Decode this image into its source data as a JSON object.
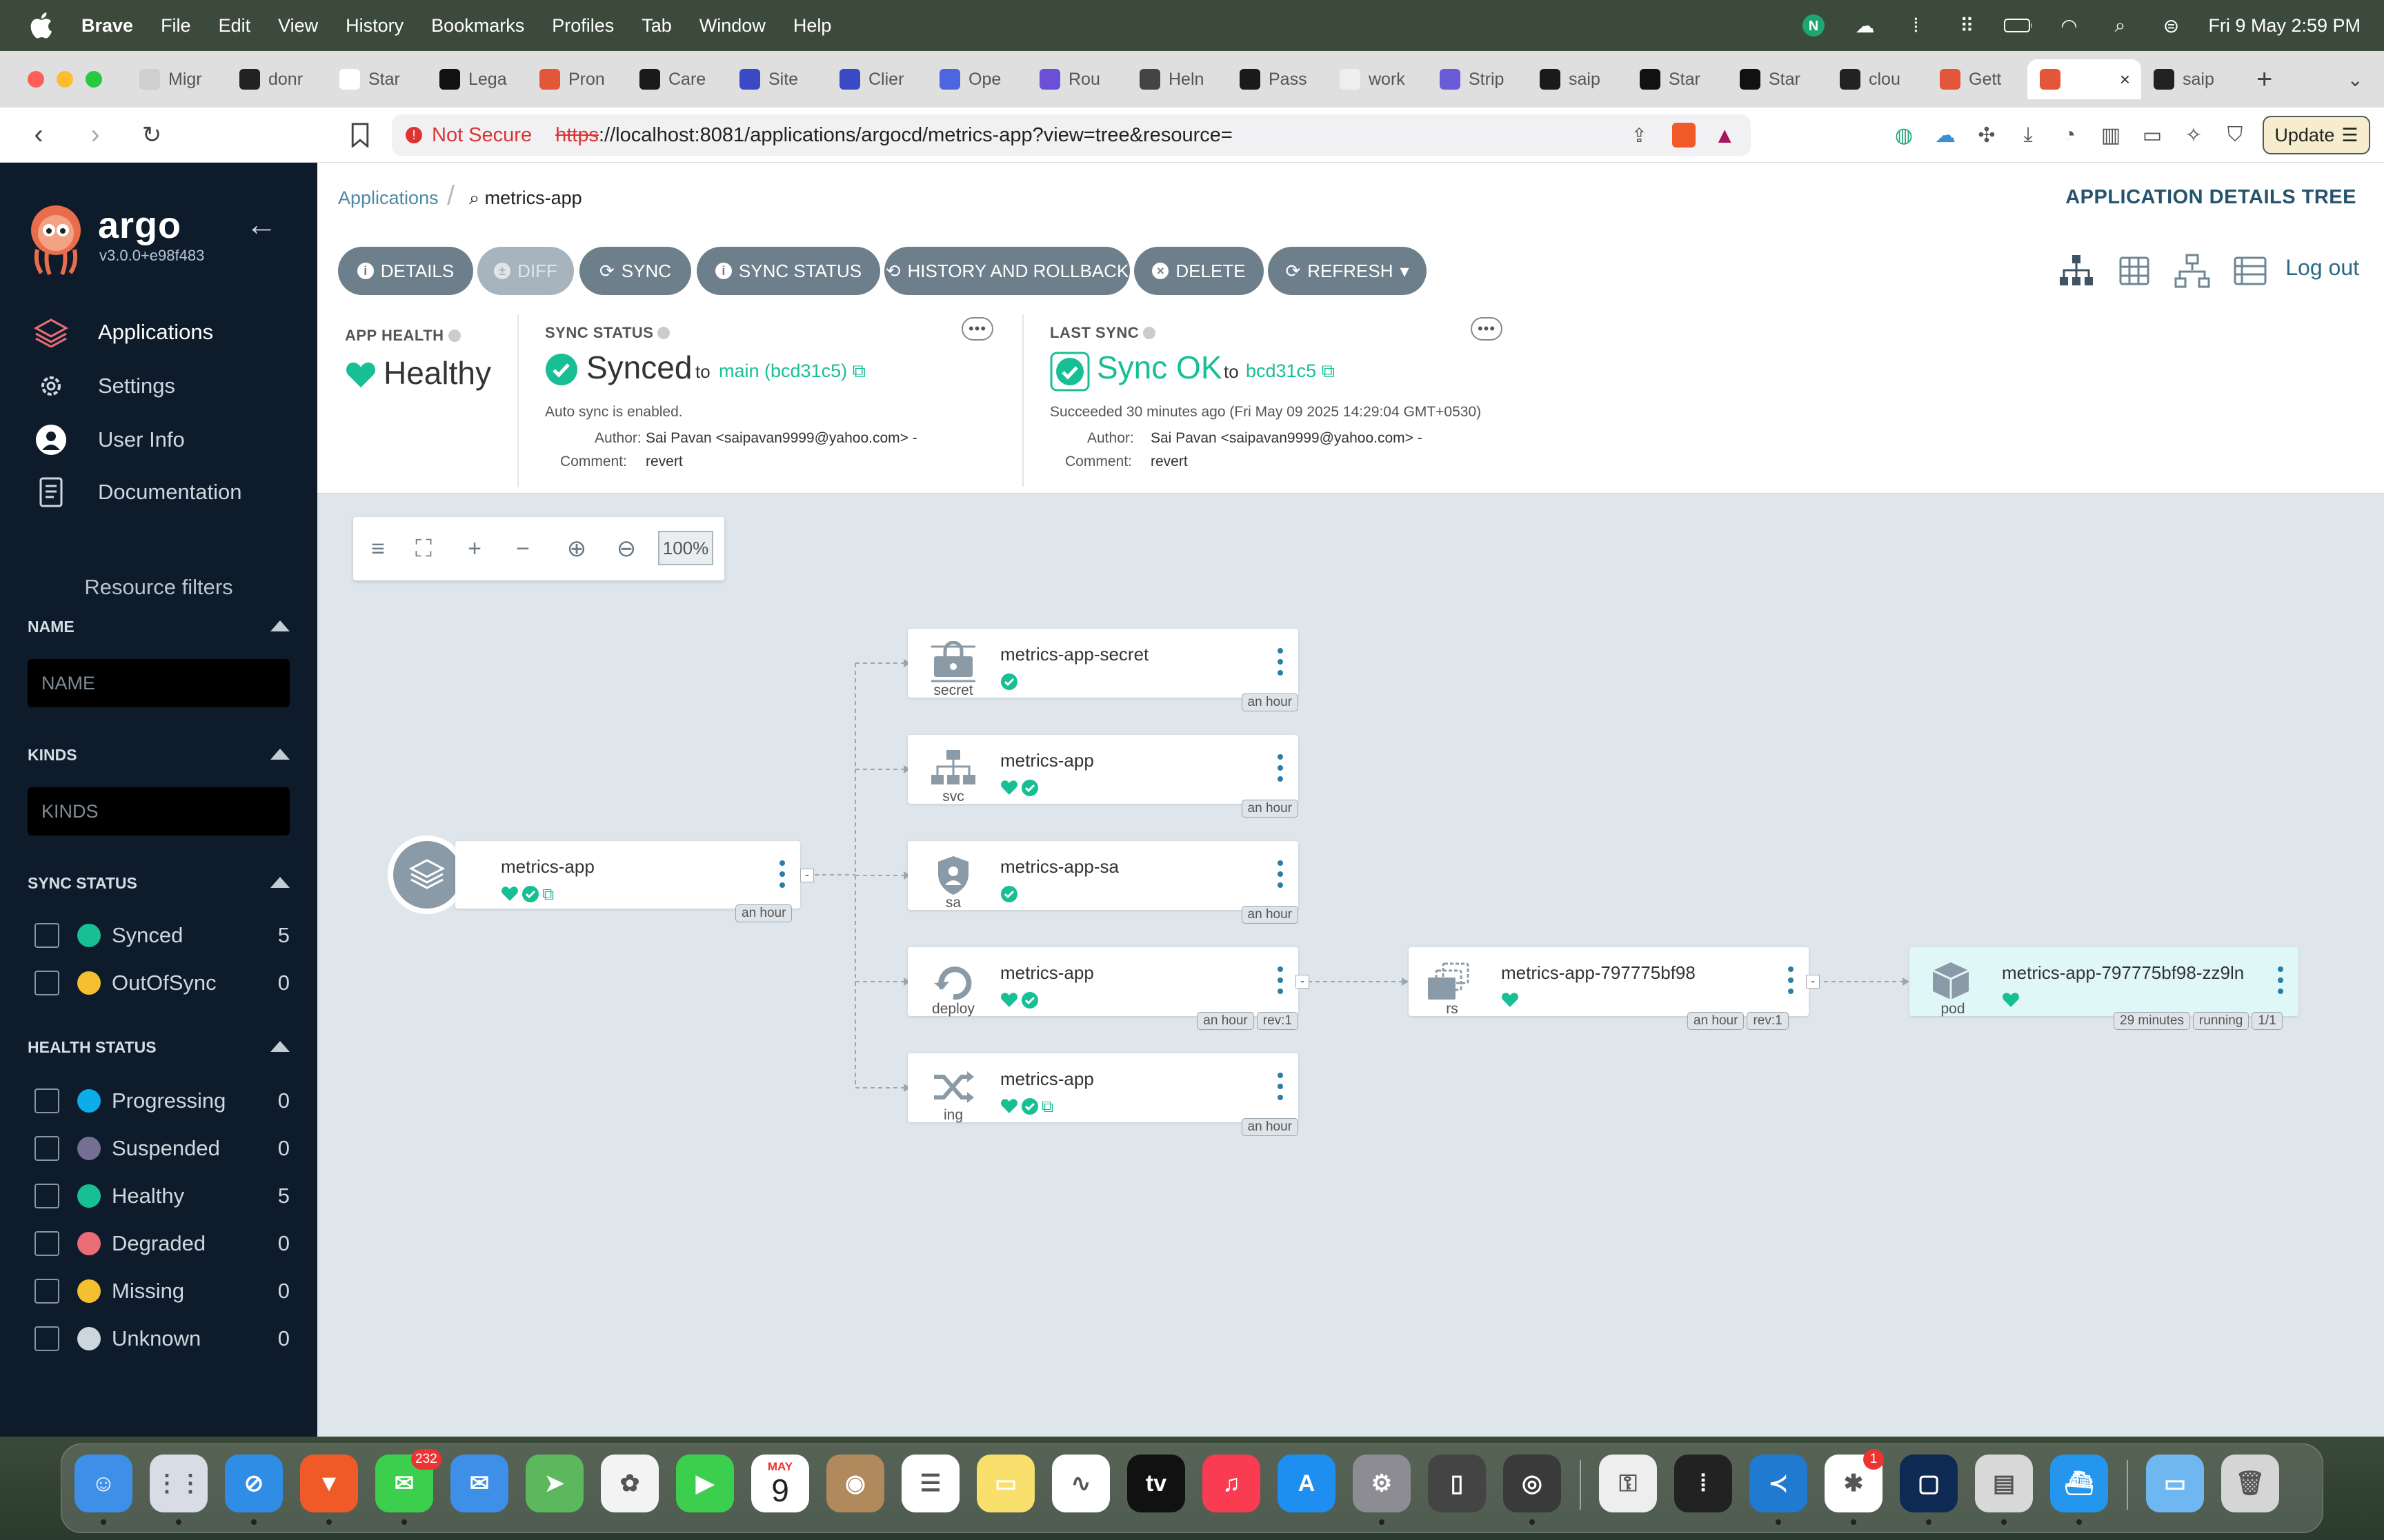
{
  "menubar": {
    "app_name": "Brave",
    "menus": [
      "File",
      "Edit",
      "View",
      "History",
      "Bookmarks",
      "Profiles",
      "Tab",
      "Window",
      "Help"
    ],
    "clock": "Fri 9 May  2:59 PM"
  },
  "tabs": [
    {
      "label": "Migr",
      "color": "#cfcfcf"
    },
    {
      "label": "donr",
      "color": "#222222"
    },
    {
      "label": "Star",
      "color": "#ffffff"
    },
    {
      "label": "Lega",
      "color": "#111111"
    },
    {
      "label": "Pron",
      "color": "#e3563a"
    },
    {
      "label": "Care",
      "color": "#1a1a1a"
    },
    {
      "label": "Site",
      "color": "#3b49c4"
    },
    {
      "label": "Clier",
      "color": "#3b49c4"
    },
    {
      "label": "Ope",
      "color": "#4d66e0"
    },
    {
      "label": "Rou",
      "color": "#6b4fd6"
    },
    {
      "label": "Heln",
      "color": "#444444"
    },
    {
      "label": "Pass",
      "color": "#1a1a1a"
    },
    {
      "label": "work",
      "color": "#eeeeee"
    },
    {
      "label": "Strip",
      "color": "#6a5bd6"
    },
    {
      "label": "saip",
      "color": "#1a1a1a"
    },
    {
      "label": "Star",
      "color": "#111111"
    },
    {
      "label": "Star",
      "color": "#111111"
    },
    {
      "label": "clou",
      "color": "#222222"
    },
    {
      "label": "Gett",
      "color": "#e3563a"
    },
    {
      "label": "",
      "color": "#e3563a",
      "active": true
    },
    {
      "label": "saip",
      "color": "#222222"
    }
  ],
  "addressbar": {
    "security": "Not Secure",
    "scheme": "https",
    "url": "://localhost:8081/applications/argocd/metrics-app?view=tree&resource=",
    "update_label": "Update"
  },
  "sidebar": {
    "brand": "argo",
    "version": "v3.0.0+e98f483",
    "nav": [
      {
        "label": "Applications",
        "active": true
      },
      {
        "label": "Settings"
      },
      {
        "label": "User Info"
      },
      {
        "label": "Documentation"
      }
    ],
    "resource_filters_title": "Resource filters",
    "name_header": "NAME",
    "name_placeholder": "NAME",
    "kinds_header": "KINDS",
    "kinds_placeholder": "KINDS",
    "sync_status_header": "SYNC STATUS",
    "sync_status": [
      {
        "label": "Synced",
        "count": "5",
        "color": "#18be94"
      },
      {
        "label": "OutOfSync",
        "count": "0",
        "color": "#f4c030"
      }
    ],
    "health_status_header": "HEALTH STATUS",
    "health_status": [
      {
        "label": "Progressing",
        "count": "0",
        "color": "#0dadea"
      },
      {
        "label": "Suspended",
        "count": "0",
        "color": "#766f94"
      },
      {
        "label": "Healthy",
        "count": "5",
        "color": "#18be94"
      },
      {
        "label": "Degraded",
        "count": "0",
        "color": "#e96d76"
      },
      {
        "label": "Missing",
        "count": "0",
        "color": "#f4c030"
      },
      {
        "label": "Unknown",
        "count": "0",
        "color": "#ccd6dd"
      }
    ]
  },
  "header": {
    "breadcrumb_root": "Applications",
    "breadcrumb_current": "metrics-app",
    "page_title": "APPLICATION DETAILS TREE"
  },
  "actions": {
    "details": "DETAILS",
    "diff": "DIFF",
    "sync": "SYNC",
    "sync_status": "SYNC STATUS",
    "history": "HISTORY AND ROLLBACK",
    "delete": "DELETE",
    "refresh": "REFRESH",
    "logout": "Log out"
  },
  "status": {
    "app_health_label": "APP HEALTH",
    "app_health_value": "Healthy",
    "sync_status_label": "SYNC STATUS",
    "sync_status_value": "Synced",
    "sync_to": "to",
    "sync_target": "main (bcd31c5)",
    "auto_sync": "Auto sync is enabled.",
    "author_label": "Author:",
    "author_value": "Sai Pavan <saipavan9999@yahoo.com> -",
    "comment_label": "Comment:",
    "comment_value": "revert",
    "last_sync_label": "LAST SYNC",
    "last_sync_value": "Sync OK",
    "last_sync_to": "to",
    "last_sync_target": "bcd31c5",
    "last_sync_time": "Succeeded 30 minutes ago (Fri May 09 2025 14:29:04 GMT+0530)",
    "last_author_value": "Sai Pavan <saipavan9999@yahoo.com> -",
    "last_comment_value": "revert"
  },
  "zoom": {
    "value": "100%"
  },
  "graph": {
    "app": {
      "name": "metrics-app",
      "age": "an hour"
    },
    "resources": [
      {
        "name": "metrics-app-secret",
        "kind": "secret",
        "tags": [
          "an hour"
        ],
        "health": false,
        "link": false
      },
      {
        "name": "metrics-app",
        "kind": "svc",
        "tags": [
          "an hour"
        ],
        "health": true,
        "link": false
      },
      {
        "name": "metrics-app-sa",
        "kind": "sa",
        "tags": [
          "an hour"
        ],
        "health": false,
        "link": false
      },
      {
        "name": "metrics-app",
        "kind": "deploy",
        "tags": [
          "an hour",
          "rev:1"
        ],
        "health": true,
        "link": false
      },
      {
        "name": "metrics-app",
        "kind": "ing",
        "tags": [
          "an hour"
        ],
        "health": true,
        "link": true
      }
    ],
    "replicaset": {
      "name": "metrics-app-797775bf98",
      "kind": "rs",
      "tags": [
        "an hour",
        "rev:1"
      ]
    },
    "pod": {
      "name": "metrics-app-797775bf98-zz9ln",
      "kind": "pod",
      "tags": [
        "29 minutes",
        "running",
        "1/1"
      ]
    }
  },
  "dock": {
    "messages_badge": "232",
    "calendar_month": "MAY",
    "calendar_day": "9",
    "slack_badge": "1",
    "icons": [
      "finder",
      "launchpad",
      "safari",
      "brave",
      "messages",
      "mail",
      "maps",
      "photos",
      "facetime",
      "calendar",
      "contacts",
      "reminders",
      "notes",
      "freeform",
      "tv",
      "music",
      "app-store",
      "system-settings",
      "iphone-mirroring",
      "quicktime",
      "keychain",
      "voice-memos",
      "vscode",
      "slack",
      "windows-app",
      "preview",
      "docker",
      "downloads",
      "trash"
    ]
  }
}
